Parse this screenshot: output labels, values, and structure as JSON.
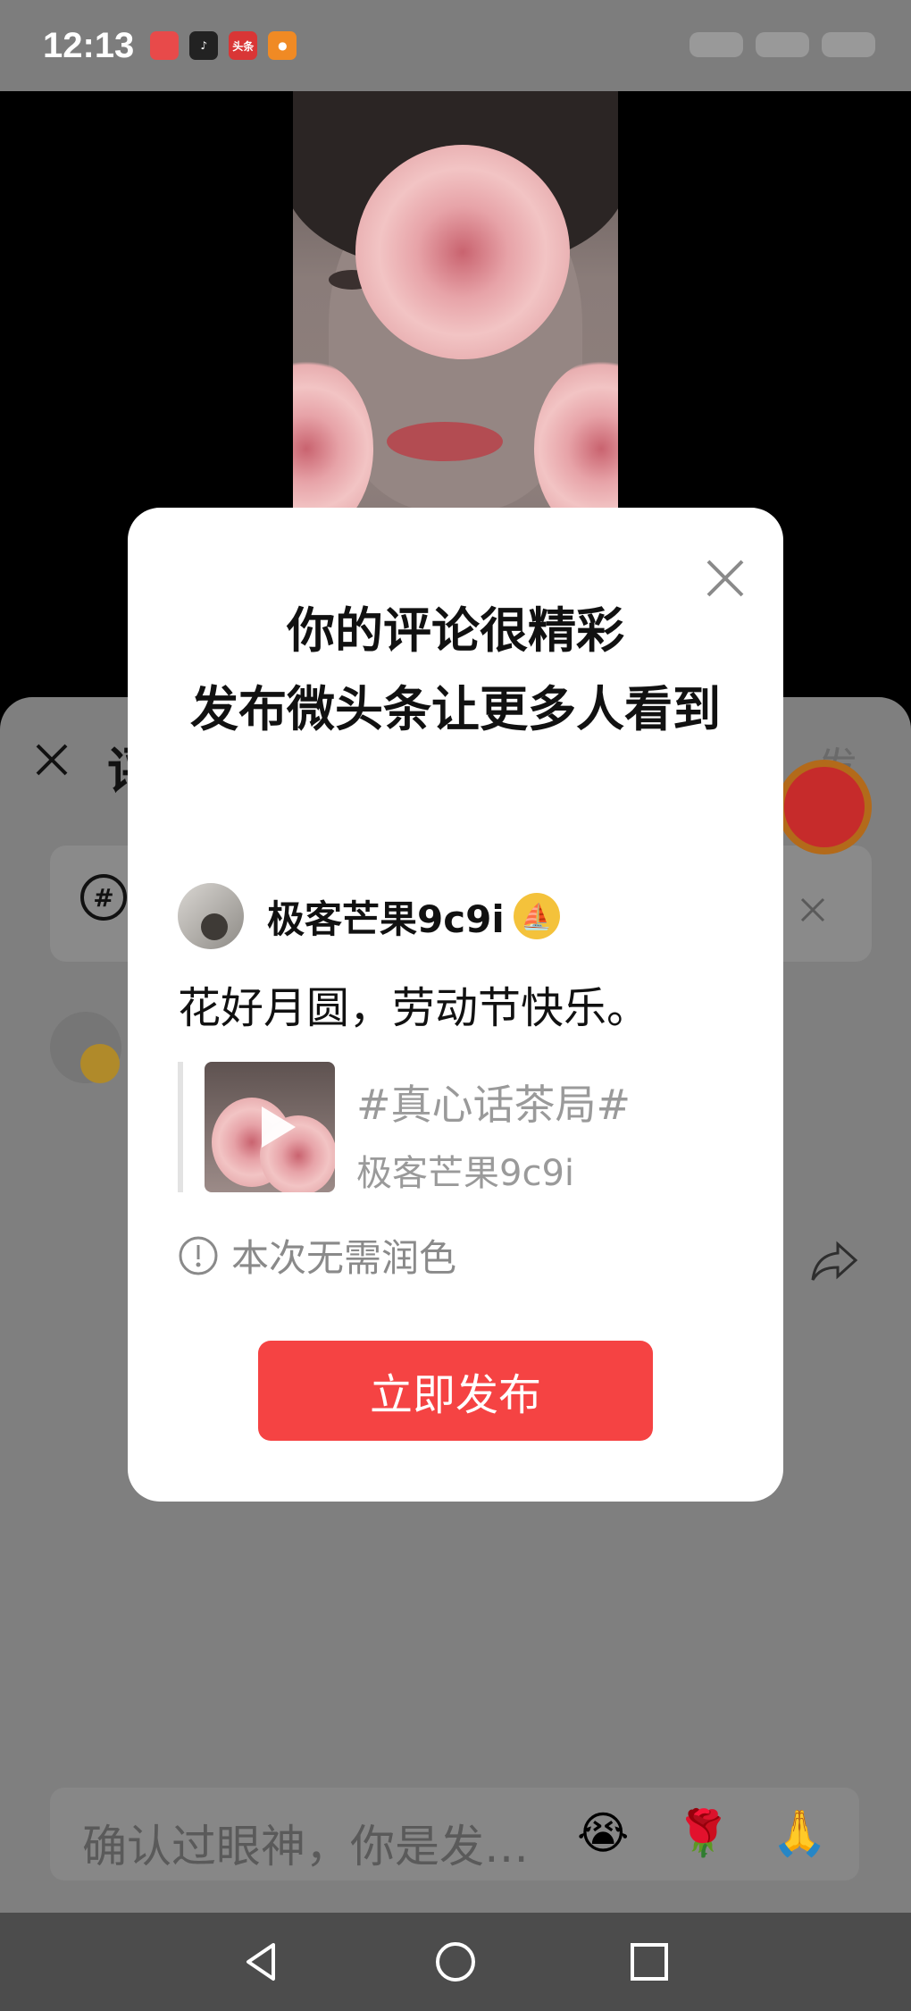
{
  "status_bar": {
    "time": "12:13",
    "apps": [
      {
        "icon": "huawei-mall-icon",
        "color": "#e84a4a",
        "label": ""
      },
      {
        "icon": "douyin-icon",
        "color": "#222222",
        "label": ""
      },
      {
        "icon": "toutiao-icon",
        "color": "#d93636",
        "label": "头条"
      },
      {
        "icon": "orange-app-icon",
        "color": "#f08a24",
        "label": ""
      }
    ]
  },
  "comment_panel": {
    "title_partial": "评",
    "right_partial": "发",
    "input_placeholder": "确认过眼神，你是发…",
    "emojis": [
      "😭",
      "🌹",
      "🙏"
    ]
  },
  "modal": {
    "title_line1": "你的评论很精彩",
    "title_line2": "发布微头条让更多人看到",
    "author_name": "极客芒果9c9i",
    "comment_text": "花好月圆，劳动节快乐。",
    "quote_topic": "#真心话茶局#",
    "quote_author": "极客芒果9c9i",
    "notice_text": "本次无需润色",
    "publish_label": "立即发布"
  },
  "colors": {
    "accent_red": "#f54343",
    "badge_gold": "#f4c23b",
    "muted_text": "#9a9a9a"
  }
}
